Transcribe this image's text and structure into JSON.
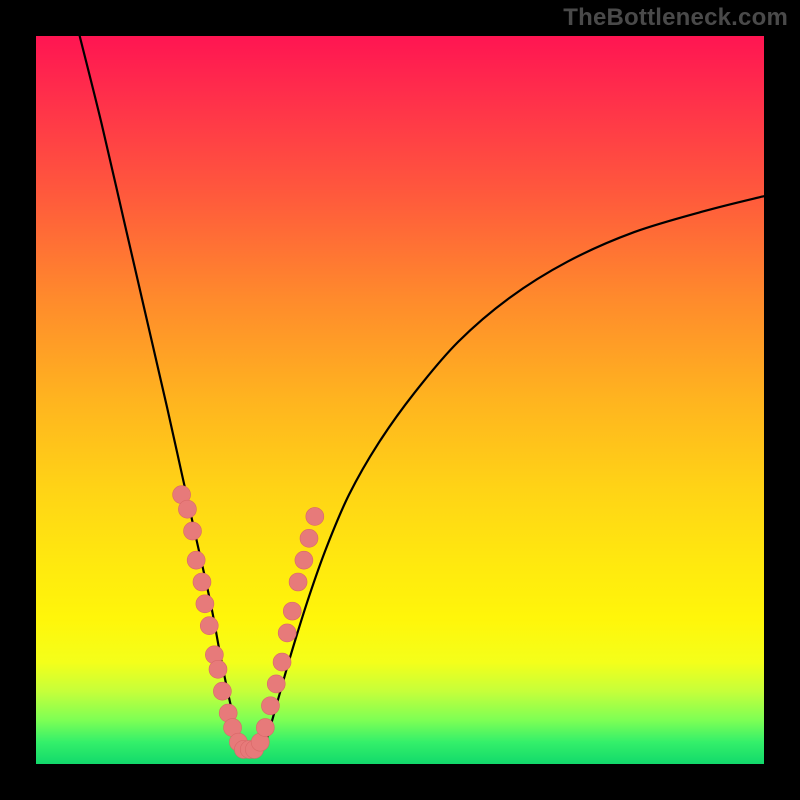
{
  "watermark": "TheBottleneck.com",
  "colors": {
    "frame_bg": "#000000",
    "marker_fill": "#e77a7a",
    "curve_stroke": "#000000",
    "watermark_text": "#4a4a4a"
  },
  "chart_data": {
    "type": "line",
    "title": "",
    "xlabel": "",
    "ylabel": "",
    "xlim": [
      0,
      100
    ],
    "ylim": [
      0,
      100
    ],
    "grid": false,
    "legend": false,
    "note": "Axes are unlabeled in the image; x/y are normalized 0-100 from the visible plot box. Curve is a V-shape with minimum near x≈28, y≈0. Values estimated from pixel positions.",
    "series": [
      {
        "name": "curve",
        "x": [
          6,
          9,
          12,
          15,
          18,
          20,
          22,
          24,
          25.5,
          27,
          28.5,
          30,
          31.5,
          33,
          35,
          37.5,
          40,
          43,
          47,
          52,
          58,
          65,
          73,
          82,
          92,
          100
        ],
        "y": [
          100,
          88,
          75,
          62,
          49,
          40,
          31,
          22,
          14,
          7,
          2,
          1,
          3,
          8,
          15,
          23,
          30,
          37,
          44,
          51,
          58,
          64,
          69,
          73,
          76,
          78
        ]
      }
    ],
    "markers": {
      "name": "pink-dots",
      "note": "Scatter of pink markers clustered along the lower portion of the V on both sides of the minimum.",
      "points": [
        {
          "x": 20.0,
          "y": 37
        },
        {
          "x": 20.8,
          "y": 35
        },
        {
          "x": 21.5,
          "y": 32
        },
        {
          "x": 22.0,
          "y": 28
        },
        {
          "x": 22.8,
          "y": 25
        },
        {
          "x": 23.2,
          "y": 22
        },
        {
          "x": 23.8,
          "y": 19
        },
        {
          "x": 24.5,
          "y": 15
        },
        {
          "x": 25.0,
          "y": 13
        },
        {
          "x": 25.6,
          "y": 10
        },
        {
          "x": 26.4,
          "y": 7
        },
        {
          "x": 27.0,
          "y": 5
        },
        {
          "x": 27.8,
          "y": 3
        },
        {
          "x": 28.5,
          "y": 2
        },
        {
          "x": 29.3,
          "y": 2
        },
        {
          "x": 30.0,
          "y": 2
        },
        {
          "x": 30.8,
          "y": 3
        },
        {
          "x": 31.5,
          "y": 5
        },
        {
          "x": 32.2,
          "y": 8
        },
        {
          "x": 33.0,
          "y": 11
        },
        {
          "x": 33.8,
          "y": 14
        },
        {
          "x": 34.5,
          "y": 18
        },
        {
          "x": 35.2,
          "y": 21
        },
        {
          "x": 36.0,
          "y": 25
        },
        {
          "x": 36.8,
          "y": 28
        },
        {
          "x": 37.5,
          "y": 31
        },
        {
          "x": 38.3,
          "y": 34
        }
      ]
    }
  }
}
